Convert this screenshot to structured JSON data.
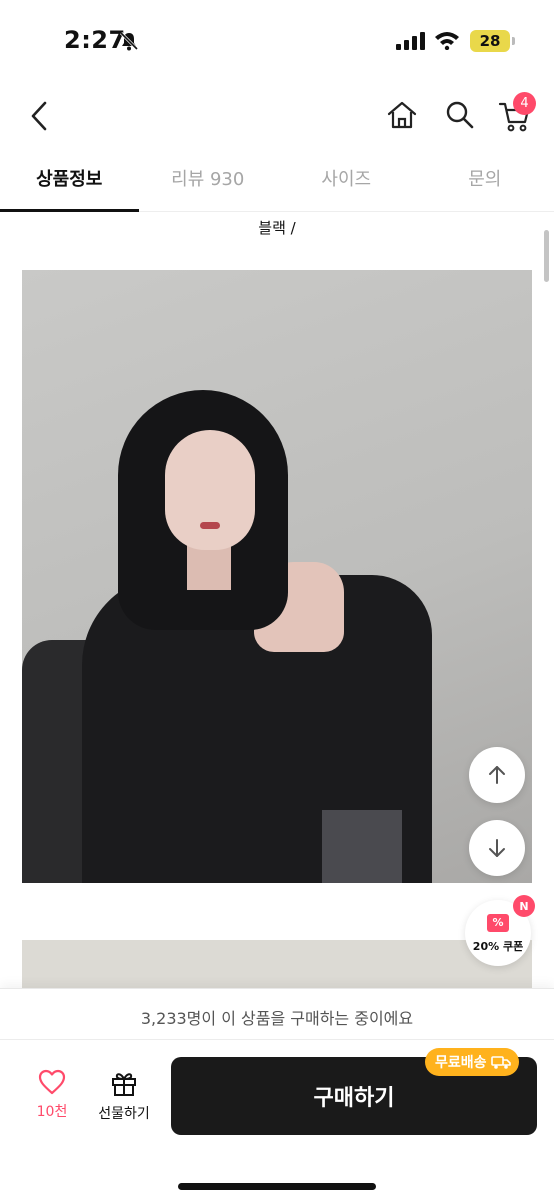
{
  "status_bar": {
    "time": "2:27",
    "battery": "28",
    "bell_icon": "bell-slash-icon",
    "signal_icon": "cellular-signal-icon",
    "wifi_icon": "wifi-icon"
  },
  "nav": {
    "back_icon": "chevron-left-icon",
    "home_icon": "home-icon",
    "search_icon": "search-icon",
    "cart_icon": "cart-icon",
    "cart_count": "4"
  },
  "tabs": [
    {
      "label": "상품정보",
      "active": true
    },
    {
      "label": "리뷰 930",
      "active": false
    },
    {
      "label": "사이즈",
      "active": false
    },
    {
      "label": "문의",
      "active": false
    }
  ],
  "product": {
    "option_text": "블랙 /"
  },
  "floating": {
    "scroll_up_icon": "arrow-up-icon",
    "scroll_down_icon": "arrow-down-icon",
    "coupon_label": "20% 쿠폰",
    "coupon_badge": "N",
    "coupon_ticket": "%"
  },
  "bottom_bar": {
    "buyers_text": "3,233명이 이 상품을 구매하는 중이에요",
    "like_count": "10천",
    "gift_label": "선물하기",
    "buy_label": "구매하기",
    "shipping_badge": "무료배송"
  },
  "colors": {
    "accent": "#ff4a6a",
    "buy_button": "#1a1a1a",
    "shipping_badge": "#ffb21d",
    "battery": "#e9d84a"
  }
}
